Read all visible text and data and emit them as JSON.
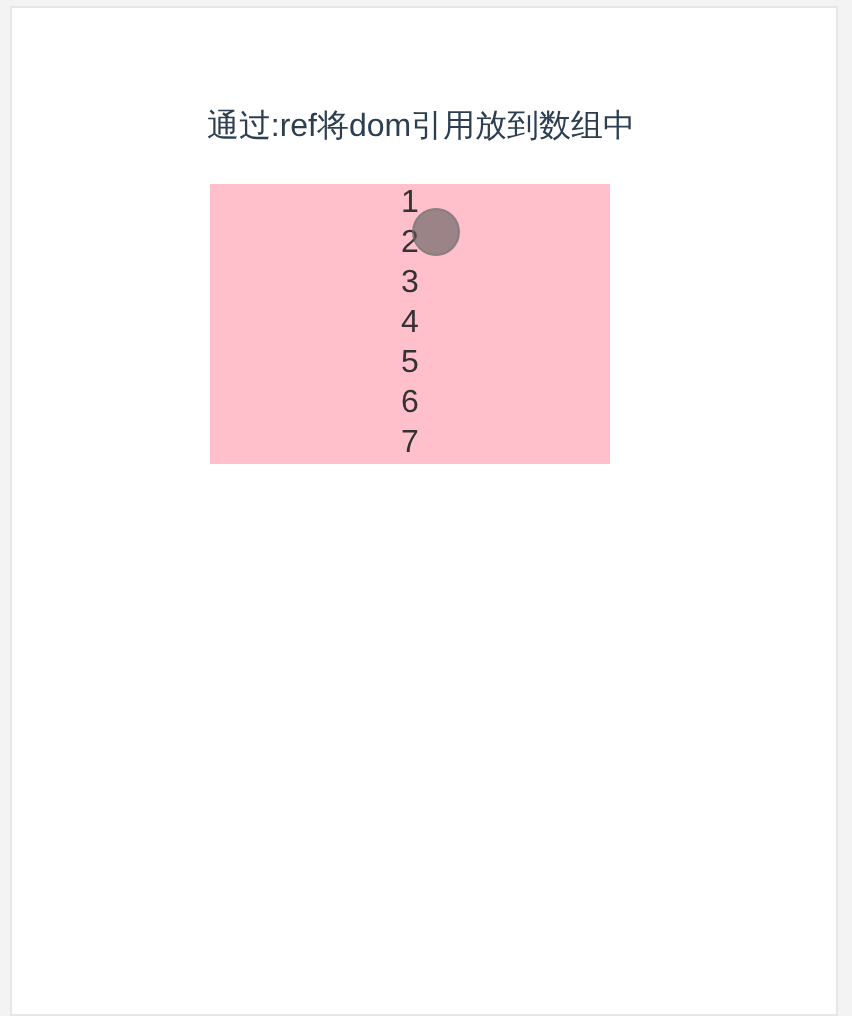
{
  "title": "通过:ref将dom引用放到数组中",
  "items": [
    "1",
    "2",
    "3",
    "4",
    "5",
    "6",
    "7"
  ]
}
